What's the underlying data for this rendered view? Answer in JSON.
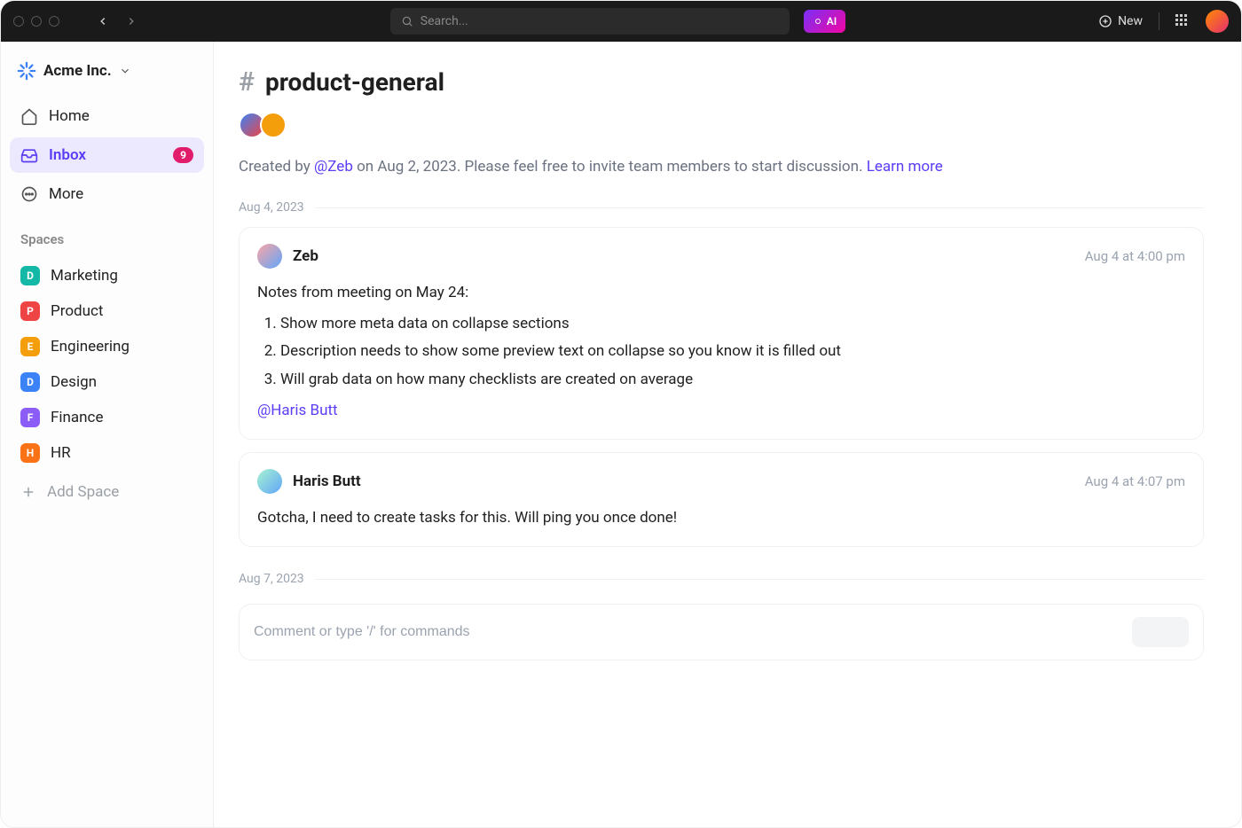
{
  "topbar": {
    "search_placeholder": "Search...",
    "ai_label": "AI",
    "new_label": "New"
  },
  "sidebar": {
    "workspace_name": "Acme Inc.",
    "nav": [
      {
        "label": "Home"
      },
      {
        "label": "Inbox",
        "badge": "9"
      },
      {
        "label": "More"
      }
    ],
    "spaces_heading": "Spaces",
    "spaces": [
      {
        "letter": "D",
        "label": "Marketing",
        "color": "#14b8a6"
      },
      {
        "letter": "P",
        "label": "Product",
        "color": "#ef4444"
      },
      {
        "letter": "E",
        "label": "Engineering",
        "color": "#f59e0b"
      },
      {
        "letter": "D",
        "label": "Design",
        "color": "#3b82f6"
      },
      {
        "letter": "F",
        "label": "Finance",
        "color": "#8b5cf6"
      },
      {
        "letter": "H",
        "label": "HR",
        "color": "#f97316"
      }
    ],
    "add_space_label": "Add Space"
  },
  "channel": {
    "name": "product-general",
    "created_prefix": "Created by ",
    "created_by": "@Zeb",
    "created_suffix": " on Aug 2, 2023. Please feel free to invite team members to start discussion. ",
    "learn_more": "Learn more"
  },
  "dates": {
    "d1": "Aug 4, 2023",
    "d2": "Aug 7, 2023"
  },
  "messages": [
    {
      "author": "Zeb",
      "time": "Aug 4 at 4:00 pm",
      "intro": "Notes from meeting on May 24:",
      "items": [
        "Show more meta data on collapse sections",
        "Description needs to show some preview text on collapse so you know it is filled out",
        "Will grab data on how many checklists are created on average"
      ],
      "mention": "@Haris Butt"
    },
    {
      "author": "Haris Butt",
      "time": "Aug 4 at 4:07 pm",
      "text": "Gotcha, I need to create tasks for this. Will ping you once done!"
    }
  ],
  "composer": {
    "placeholder": "Comment or type '/' for commands"
  }
}
